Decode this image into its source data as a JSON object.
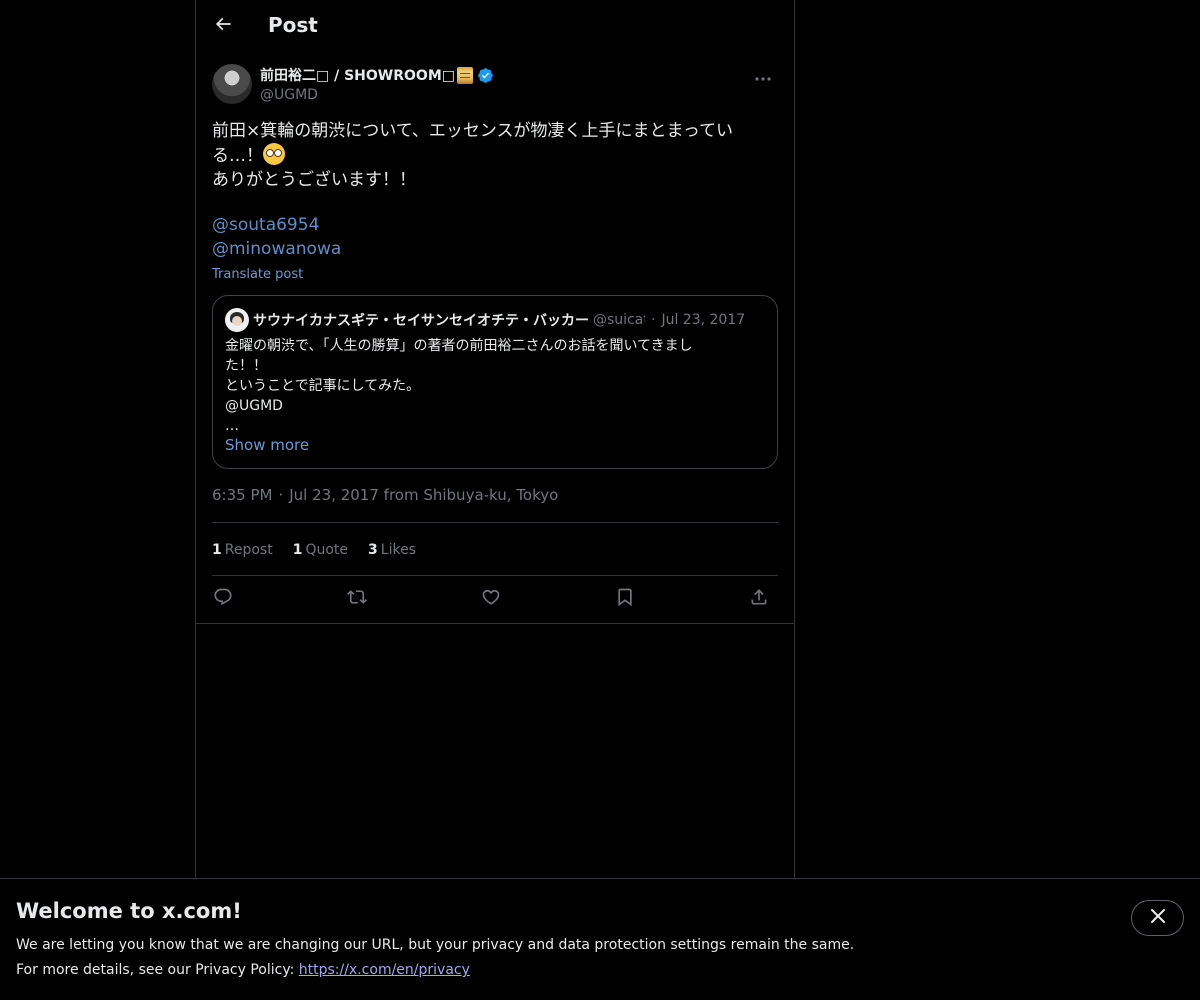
{
  "header": {
    "back_icon": "arrow-left-icon",
    "title": "Post"
  },
  "post": {
    "author": {
      "name": "前田裕二□ / SHOWROOM□",
      "verified": true,
      "handle": "@UGMD",
      "badge_emoji": "scroll-emoji",
      "verified_icon": "verified-badge-icon"
    },
    "text_lines": [
      "前田×箕輪の朝渋について、エッセンスが物凄く上手にまとまってい",
      "る…！",
      "ありがとうございます！！"
    ],
    "text_emoji": "flushed-face-emoji",
    "mentions": [
      "@souta6954",
      "@minowanowa"
    ],
    "translate_label": "Translate post",
    "quote": {
      "name": "サウナイカナスギテ・セイサンセイオチテ・バッカー",
      "handle": "@suicat",
      "separator": "·",
      "date": "Jul 23, 2017",
      "body_lines": [
        "金曜の朝渋で、「人生の勝算」の著者の前田裕二さんのお話を聞いてきまし",
        "た！！",
        "ということで記事にしてみた。",
        "@UGMD",
        "…"
      ],
      "show_more_label": "Show more"
    },
    "time": "6:35 PM",
    "meta_separator": "·",
    "date_location": "Jul 23, 2017 from Shibuya-ku, Tokyo",
    "stats": [
      {
        "count": "1",
        "label": "Repost"
      },
      {
        "count": "1",
        "label": "Quote"
      },
      {
        "count": "3",
        "label": "Likes"
      }
    ],
    "actions": [
      "reply-icon",
      "repost-icon",
      "like-icon",
      "bookmark-icon",
      "share-icon"
    ]
  },
  "banner": {
    "title": "Welcome to x.com!",
    "line1": "We are letting you know that we are changing our URL, but your privacy and data protection settings remain the same.",
    "line2_prefix": "For more details, see our Privacy Policy: ",
    "link_text": "https://x.com/en/privacy",
    "close_icon": "close-icon"
  },
  "colors": {
    "background": "#000000",
    "text": "#e7e9ea",
    "muted": "#71767b",
    "link": "#5d8ec9",
    "verified": "#1d9bf0",
    "border": "#2f3336"
  }
}
